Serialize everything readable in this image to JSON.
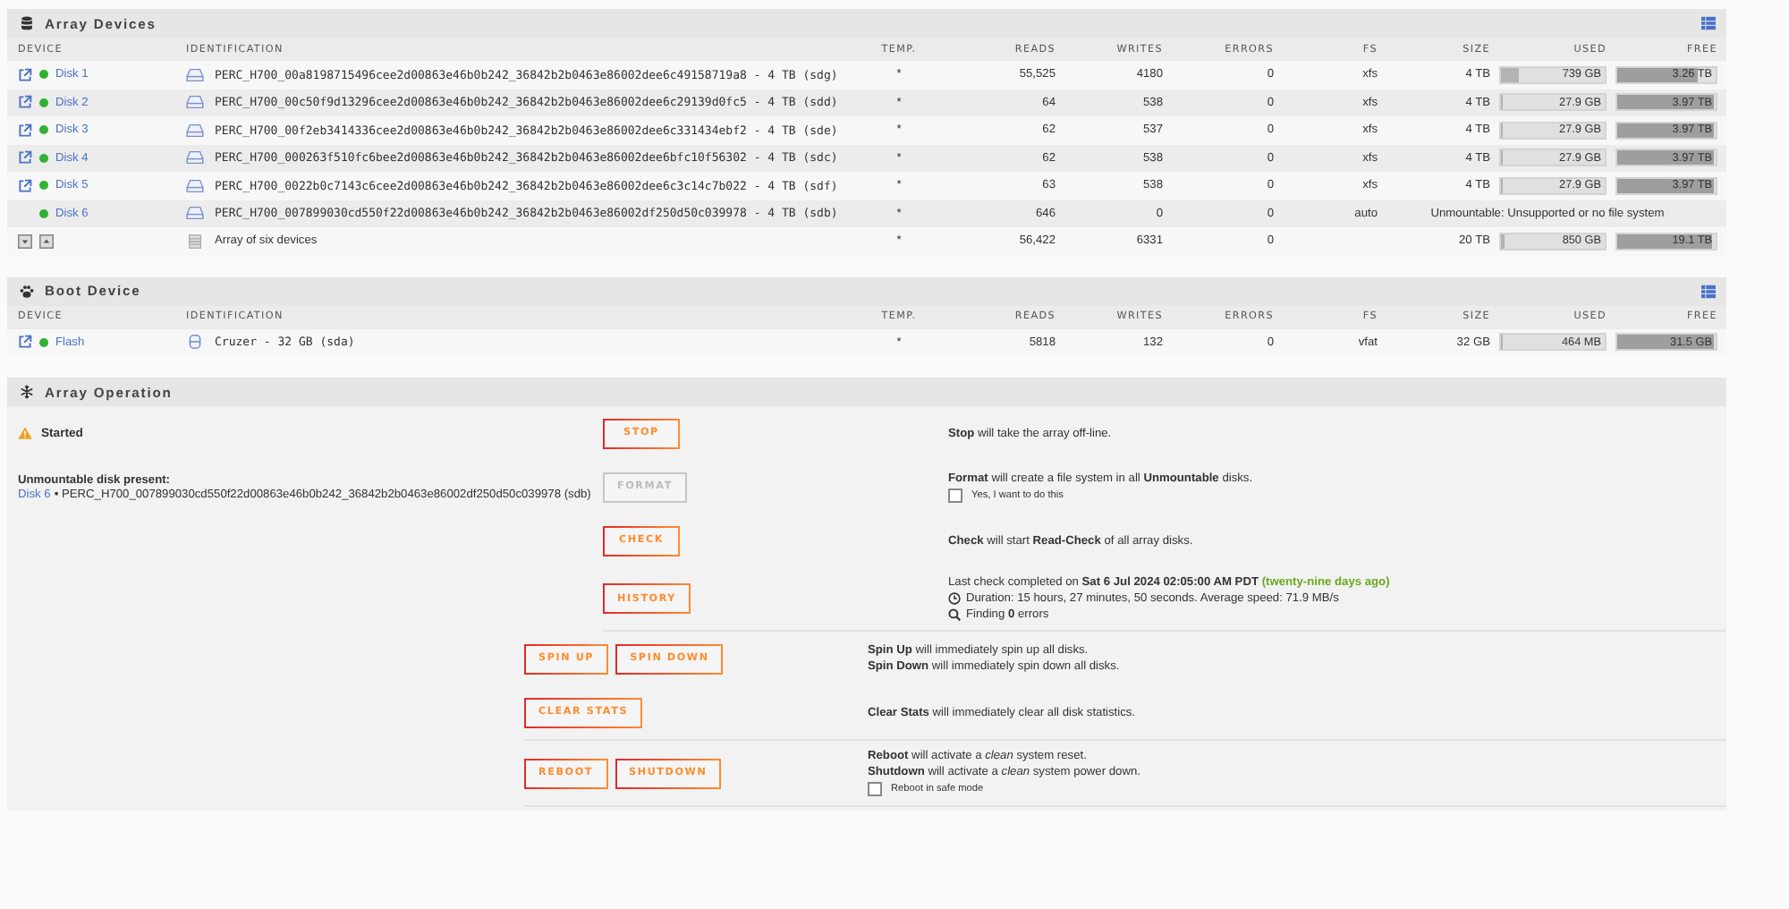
{
  "array_devices": {
    "title": "Array Devices",
    "columns": [
      "DEVICE",
      "IDENTIFICATION",
      "TEMP.",
      "READS",
      "WRITES",
      "ERRORS",
      "FS",
      "SIZE",
      "USED",
      "FREE"
    ],
    "rows": [
      {
        "kind": "disk",
        "settings_link": true,
        "color": "#31b131",
        "device": "Disk 1",
        "identification": "PERC_H700_00a8198715496cee2d00863e46b0b242_36842b2b0463e86002dee6c49158719a8 - 4 TB (sdg)",
        "temp": "*",
        "reads": "55,525",
        "writes": "4180",
        "errors": "0",
        "fs": "xfs",
        "size": "4 TB",
        "used": {
          "text": "739 GB",
          "level": 0.18
        },
        "free": {
          "text": "3.26 TB",
          "level": 0.82
        }
      },
      {
        "kind": "disk",
        "settings_link": true,
        "color": "#31b131",
        "device": "Disk 2",
        "identification": "PERC_H700_00c50f9d13296cee2d00863e46b0b242_36842b2b0463e86002dee6c29139d0fc5 - 4 TB (sdd)",
        "temp": "*",
        "reads": "64",
        "writes": "538",
        "errors": "0",
        "fs": "xfs",
        "size": "4 TB",
        "used": {
          "text": "27.9 GB",
          "level": 0.01
        },
        "free": {
          "text": "3.97 TB",
          "level": 0.99
        }
      },
      {
        "kind": "disk",
        "settings_link": true,
        "color": "#31b131",
        "device": "Disk 3",
        "identification": "PERC_H700_00f2eb3414336cee2d00863e46b0b242_36842b2b0463e86002dee6c331434ebf2 - 4 TB (sde)",
        "temp": "*",
        "reads": "62",
        "writes": "537",
        "errors": "0",
        "fs": "xfs",
        "size": "4 TB",
        "used": {
          "text": "27.9 GB",
          "level": 0.01
        },
        "free": {
          "text": "3.97 TB",
          "level": 0.99
        }
      },
      {
        "kind": "disk",
        "settings_link": true,
        "color": "#31b131",
        "device": "Disk 4",
        "identification": "PERC_H700_000263f510fc6bee2d00863e46b0b242_36842b2b0463e86002dee6bfc10f56302 - 4 TB (sdc)",
        "temp": "*",
        "reads": "62",
        "writes": "538",
        "errors": "0",
        "fs": "xfs",
        "size": "4 TB",
        "used": {
          "text": "27.9 GB",
          "level": 0.01
        },
        "free": {
          "text": "3.97 TB",
          "level": 0.99
        }
      },
      {
        "kind": "disk",
        "settings_link": true,
        "color": "#31b131",
        "device": "Disk 5",
        "identification": "PERC_H700_0022b0c7143c6cee2d00863e46b0b242_36842b2b0463e86002dee6c3c14c7b022 - 4 TB (sdf)",
        "temp": "*",
        "reads": "63",
        "writes": "538",
        "errors": "0",
        "fs": "xfs",
        "size": "4 TB",
        "used": {
          "text": "27.9 GB",
          "level": 0.01
        },
        "free": {
          "text": "3.97 TB",
          "level": 0.99
        }
      },
      {
        "kind": "unmountable",
        "settings_link": false,
        "color": "#31b131",
        "device": "Disk 6",
        "identification": "PERC_H700_007899030cd550f22d00863e46b0b242_36842b2b0463e86002df250d50c039978 - 4 TB (sdb)",
        "temp": "*",
        "reads": "646",
        "writes": "0",
        "errors": "0",
        "fs": "auto",
        "status": "Unmountable: Unsupported or no file system"
      },
      {
        "kind": "total",
        "identification": "Array of six devices",
        "temp": "*",
        "reads": "56,422",
        "writes": "6331",
        "errors": "0",
        "size": "20 TB",
        "used": {
          "text": "850 GB",
          "level": 0.04
        },
        "free": {
          "text": "19.1 TB",
          "level": 0.96
        }
      }
    ]
  },
  "boot_device": {
    "title": "Boot Device",
    "columns": [
      "DEVICE",
      "IDENTIFICATION",
      "TEMP.",
      "READS",
      "WRITES",
      "ERRORS",
      "FS",
      "SIZE",
      "USED",
      "FREE"
    ],
    "rows": [
      {
        "kind": "flash",
        "settings_link": true,
        "color": "#31b131",
        "device": "Flash",
        "identification": "Cruzer - 32 GB (sda)",
        "temp": "*",
        "reads": "5818",
        "writes": "132",
        "errors": "0",
        "fs": "vfat",
        "size": "32 GB",
        "used": {
          "text": "464 MB",
          "level": 0.015
        },
        "free": {
          "text": "31.5 GB",
          "level": 0.985
        }
      }
    ]
  },
  "array_operation": {
    "title": "Array Operation",
    "state": "Started",
    "unmountable": {
      "title": "Unmountable disk present:",
      "disk": "Disk 6",
      "detail": "• PERC_H700_007899030cd550f22d00863e46b0b242_36842b2b0463e86002df250d50c039978 (sdb)"
    },
    "actions": [
      {
        "buttons": [
          {
            "label": "STOP",
            "disabled": false
          }
        ],
        "lines": [
          {
            "kind": "text",
            "text": "**Stop** will take the array off-line."
          }
        ]
      },
      {
        "buttons": [
          {
            "label": "FORMAT",
            "disabled": true
          }
        ],
        "lines": [
          {
            "kind": "text",
            "text": "**Format** will create a file system in all **Unmountable** disks."
          },
          {
            "kind": "checkbox",
            "label": "Yes, I want to do this",
            "checked": false
          }
        ]
      },
      {
        "buttons": [
          {
            "label": "CHECK",
            "disabled": false
          }
        ],
        "lines": [
          {
            "kind": "text",
            "text": "**Check** will start **Read-Check** of all array disks."
          }
        ]
      },
      {
        "buttons": [
          {
            "label": "HISTORY",
            "disabled": false
          }
        ],
        "lines": [
          {
            "kind": "text",
            "text": "Last check completed on **Sat 6 Jul 2024 02:05:00 AM PDT**",
            "note": "(twenty-nine days ago)"
          },
          {
            "kind": "clock",
            "text": "Duration: 15 hours, 27 minutes, 50 seconds. Average speed: 71.9 MB/s"
          },
          {
            "kind": "search",
            "text": "Finding **0** errors"
          }
        ]
      }
    ],
    "system_groups": [
      {
        "actions": [
          {
            "buttons": [
              {
                "label": "SPIN UP",
                "disabled": false
              },
              {
                "label": "SPIN DOWN",
                "disabled": false
              }
            ],
            "lines": [
              {
                "kind": "text",
                "text": "**Spin Up** will immediately spin up all disks."
              },
              {
                "kind": "text",
                "text": "**Spin Down** will immediately spin down all disks."
              }
            ]
          },
          {
            "buttons": [
              {
                "label": "CLEAR STATS",
                "disabled": false
              }
            ],
            "lines": [
              {
                "kind": "text",
                "text": "**Clear Stats** will immediately clear all disk statistics."
              }
            ]
          }
        ]
      },
      {
        "actions": [
          {
            "buttons": [
              {
                "label": "REBOOT",
                "disabled": false
              },
              {
                "label": "SHUTDOWN",
                "disabled": false
              }
            ],
            "lines": [
              {
                "kind": "text",
                "text": "**Reboot** will activate a *clean* system reset."
              },
              {
                "kind": "text",
                "text": "**Shutdown** will activate a *clean* system power down."
              },
              {
                "kind": "checkbox",
                "label": "Reboot in safe mode",
                "checked": false
              }
            ]
          }
        ]
      }
    ]
  }
}
